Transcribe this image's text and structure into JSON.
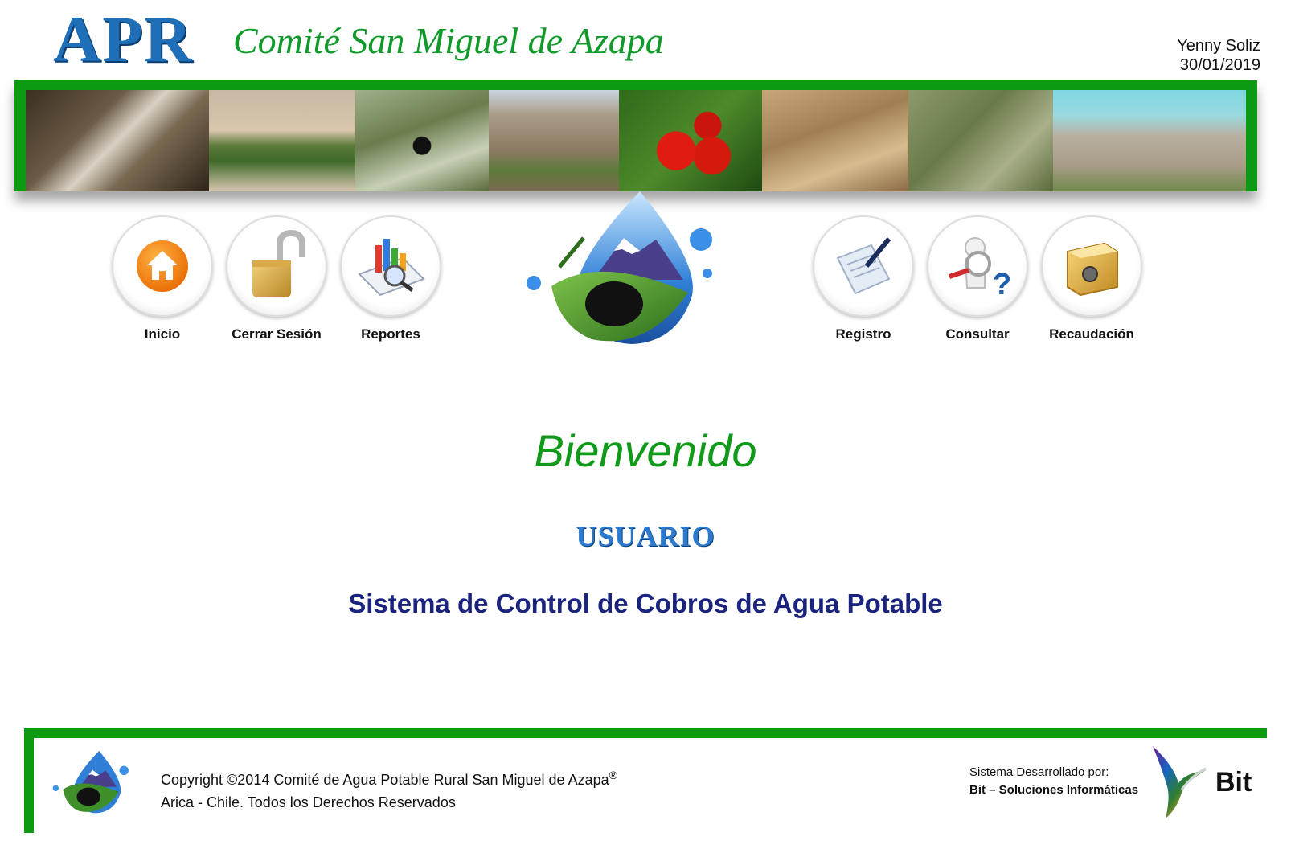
{
  "header": {
    "logo_acronym": "APR",
    "logo_title": "Comité San Miguel de Azapa",
    "user_name": "Yenny Soliz",
    "date": "30/01/2019"
  },
  "nav_left": [
    {
      "label": "Inicio",
      "icon": "home-icon"
    },
    {
      "label": "Cerrar Sesión",
      "icon": "padlock-icon"
    },
    {
      "label": "Reportes",
      "icon": "reports-icon"
    }
  ],
  "nav_right": [
    {
      "label": "Registro",
      "icon": "document-pen-icon"
    },
    {
      "label": "Consultar",
      "icon": "magnifier-question-icon"
    },
    {
      "label": "Recaudación",
      "icon": "safe-icon"
    }
  ],
  "main": {
    "welcome": "Bienvenido",
    "role": "USUARIO",
    "system_title": "Sistema de Control de Cobros de Agua Potable"
  },
  "footer": {
    "copyright_line1": "Copyright ©2014 Comité de Agua Potable Rural San Miguel de Azapa",
    "registered_mark": "®",
    "copyright_line2": "Arica - Chile. Todos los Derechos Reservados",
    "developed_by_label": "Sistema Desarrollado por:",
    "developer_name": "Bit – Soluciones Informáticas",
    "developer_logo_text": "Bit"
  },
  "colors": {
    "brand_green": "#0c9a12",
    "brand_blue": "#1f6fb8",
    "title_navy": "#1a237e"
  }
}
